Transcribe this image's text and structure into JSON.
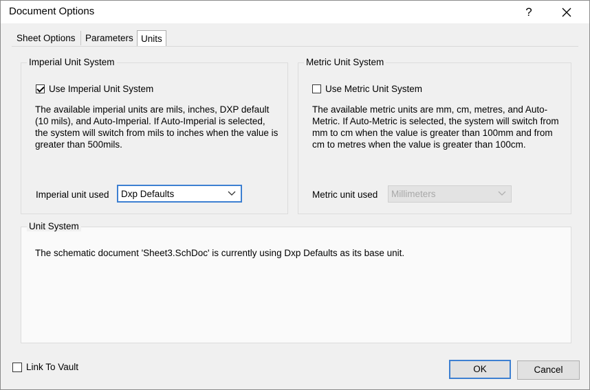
{
  "window": {
    "title": "Document Options",
    "help_label": "?",
    "close_label": "✕"
  },
  "tabs": [
    {
      "label": "Sheet Options"
    },
    {
      "label": "Parameters"
    },
    {
      "label": "Units",
      "active": true
    }
  ],
  "imperial": {
    "group_label": "Imperial Unit System",
    "checkbox_label": "Use Imperial Unit System",
    "checked": true,
    "description": "The available imperial units are mils, inches, DXP default (10 mils), and Auto-Imperial. If Auto-Imperial is selected, the system will switch from mils to inches when the value is greater than 500mils.",
    "unit_label": "Imperial unit used",
    "unit_value": "Dxp Defaults"
  },
  "metric": {
    "group_label": "Metric Unit System",
    "checkbox_label": "Use Metric Unit System",
    "checked": false,
    "description": "The available metric units are mm, cm,  metres, and Auto-Metric. If Auto-Metric is selected, the system will switch from mm to cm when the value is greater than 100mm and from cm to metres when the value is greater than 100cm.",
    "unit_label": "Metric unit used",
    "unit_value": "Millimeters"
  },
  "unit_system": {
    "group_label": "Unit  System",
    "message": "The schematic document 'Sheet3.SchDoc' is currently using Dxp Defaults as its base unit."
  },
  "footer": {
    "link_vault_label": "Link To Vault",
    "link_vault_checked": false,
    "ok_label": "OK",
    "cancel_label": "Cancel"
  },
  "colors": {
    "focus_accent": "#3c7fd1",
    "dialog_bg": "#f0f0f0"
  }
}
